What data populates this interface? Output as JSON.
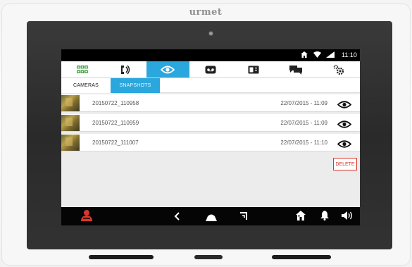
{
  "device": {
    "brand": "urmet"
  },
  "statusbar": {
    "time": "11:10"
  },
  "toolbar": {
    "tabs": [
      {
        "icon": "grid-icon",
        "active": false
      },
      {
        "icon": "phone-call-icon",
        "active": false
      },
      {
        "icon": "eye-icon",
        "active": true
      },
      {
        "icon": "voicemail-icon",
        "active": false
      },
      {
        "icon": "intercom-icon",
        "active": false
      },
      {
        "icon": "chat-icon",
        "active": false
      },
      {
        "icon": "settings-icon",
        "active": false
      }
    ]
  },
  "subtabs": {
    "cameras": "CAMERAS",
    "snapshots": "SNAPSHOTS"
  },
  "snapshots": [
    {
      "name": "20150722_110958",
      "date": "22/07/2015 - 11:09"
    },
    {
      "name": "20150722_110959",
      "date": "22/07/2015 - 11:09"
    },
    {
      "name": "20150722_111007",
      "date": "22/07/2015 - 11:10"
    }
  ],
  "actions": {
    "delete_label": "DELETE"
  },
  "colors": {
    "accent": "#2aa7dc",
    "delete": "#d8372b",
    "alarm": "#d8372b",
    "grid": "#3aa03a"
  }
}
